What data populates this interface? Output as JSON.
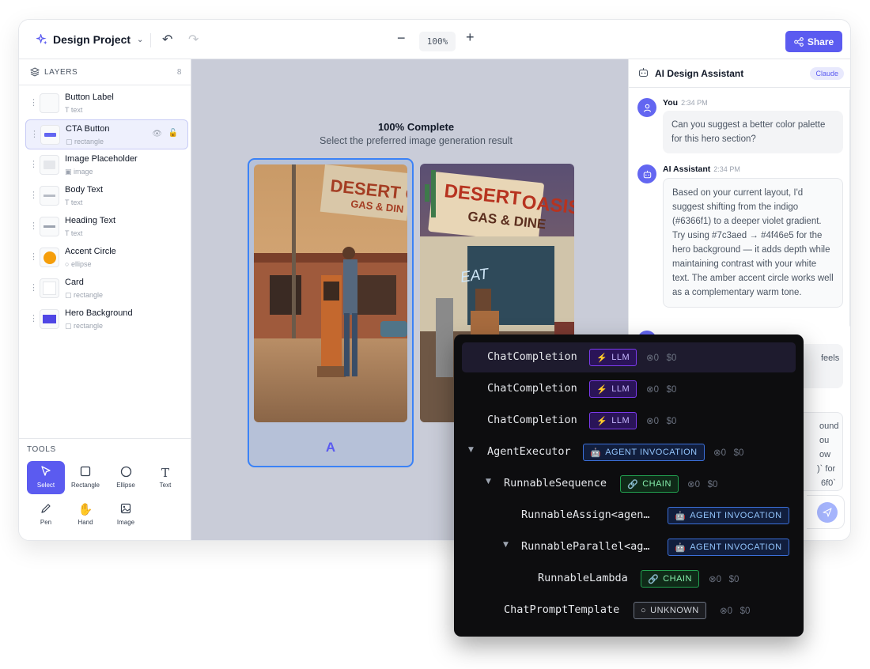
{
  "header": {
    "project_name": "Design Project",
    "zoom": "100%",
    "share_label": "Share"
  },
  "layers": {
    "title": "LAYERS",
    "count": "8",
    "items": [
      {
        "name": "Button Label",
        "type": "text"
      },
      {
        "name": "CTA Button",
        "type": "rectangle"
      },
      {
        "name": "Image Placeholder",
        "type": "image"
      },
      {
        "name": "Body Text",
        "type": "text"
      },
      {
        "name": "Heading Text",
        "type": "text"
      },
      {
        "name": "Accent Circle",
        "type": "ellipse"
      },
      {
        "name": "Card",
        "type": "rectangle"
      },
      {
        "name": "Hero Background",
        "type": "rectangle"
      }
    ]
  },
  "tools": {
    "title": "TOOLS",
    "items": [
      "Select",
      "Rectangle",
      "Ellipse",
      "Text",
      "Pen",
      "Hand",
      "Image"
    ]
  },
  "canvas": {
    "progress_title": "100% Complete",
    "subtitle": "Select the preferred image generation result",
    "option_a_label": "A"
  },
  "assistant": {
    "title": "AI Design Assistant",
    "model_badge": "Claude",
    "messages": [
      {
        "author": "You",
        "time": "2:34 PM",
        "text": "Can you suggest a better color palette for this hero section?"
      },
      {
        "author": "AI Assistant",
        "time": "2:34 PM",
        "text": "Based on your current layout, I'd suggest shifting from the indigo (#6366f1) to a deeper violet gradient. Try using #7c3aed → #4f46e5 for the hero background — it adds depth while maintaining contrast with your white text. The amber accent circle works well as a complementary warm tone."
      }
    ],
    "partial_texts": [
      "feels",
      "ound",
      "ou",
      "ow",
      ")` for",
      "6f0`"
    ]
  },
  "trace": {
    "rows": [
      {
        "name": "ChatCompletion",
        "tag": "LLM",
        "kind": "llm",
        "tokens": "0",
        "cost": "$0"
      },
      {
        "name": "ChatCompletion",
        "tag": "LLM",
        "kind": "llm",
        "tokens": "0",
        "cost": "$0"
      },
      {
        "name": "ChatCompletion",
        "tag": "LLM",
        "kind": "llm",
        "tokens": "0",
        "cost": "$0"
      },
      {
        "name": "AgentExecutor",
        "tag": "AGENT INVOCATION",
        "kind": "agent",
        "tokens": "0",
        "cost": "$0"
      },
      {
        "name": "RunnableSequence",
        "tag": "CHAIN",
        "kind": "chain",
        "tokens": "0",
        "cost": "$0"
      },
      {
        "name": "RunnableAssign<agen…",
        "tag": "AGENT INVOCATION",
        "kind": "agent",
        "tokens": "",
        "cost": ""
      },
      {
        "name": "RunnableParallel<ag…",
        "tag": "AGENT INVOCATION",
        "kind": "agent",
        "tokens": "",
        "cost": ""
      },
      {
        "name": "RunnableLambda",
        "tag": "CHAIN",
        "kind": "chain",
        "tokens": "0",
        "cost": "$0"
      },
      {
        "name": "ChatPromptTemplate",
        "tag": "UNKNOWN",
        "kind": "unknown",
        "tokens": "0",
        "cost": "$0"
      }
    ]
  },
  "colors": {
    "accent": "#5b5bf0",
    "selection": "#3b82f6",
    "amber": "#f59e0b"
  }
}
